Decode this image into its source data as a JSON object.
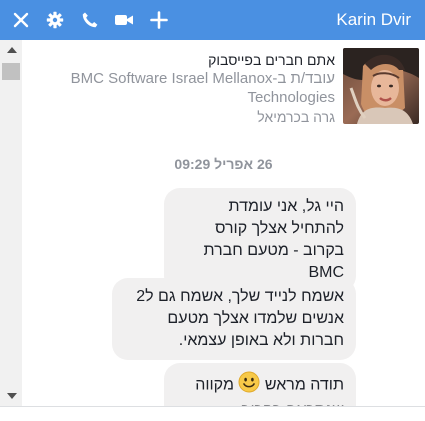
{
  "header": {
    "title": "Karin Dvir",
    "bg_color": "#4a90e2",
    "icons": [
      "close-icon",
      "gear-icon",
      "phone-icon",
      "video-camera-icon",
      "plus-icon"
    ]
  },
  "profile": {
    "name": "אתם חברים בפייסבוק",
    "work": "עובד/ת ב-Mellanox‏ BMC Software Israel Technologies",
    "location": "גרה בכרמיאל"
  },
  "chat": {
    "date_label": "26 אפריל 09:29",
    "messages": [
      {
        "text": "היי גל, אני עומדת להתחיל אצלך קורס בקרוב - מטעם חברת BMC"
      },
      {
        "text": "אשמח לנייד שלך, אשמח גם ל2 אנשים שלמדו אצלך מטעם חברות ולא באופן עצמאי."
      },
      {
        "text_before": "תודה מראש",
        "emoji": "smiley-emoji",
        "text_after": "מקווה שנתראה בקרוב"
      }
    ]
  }
}
